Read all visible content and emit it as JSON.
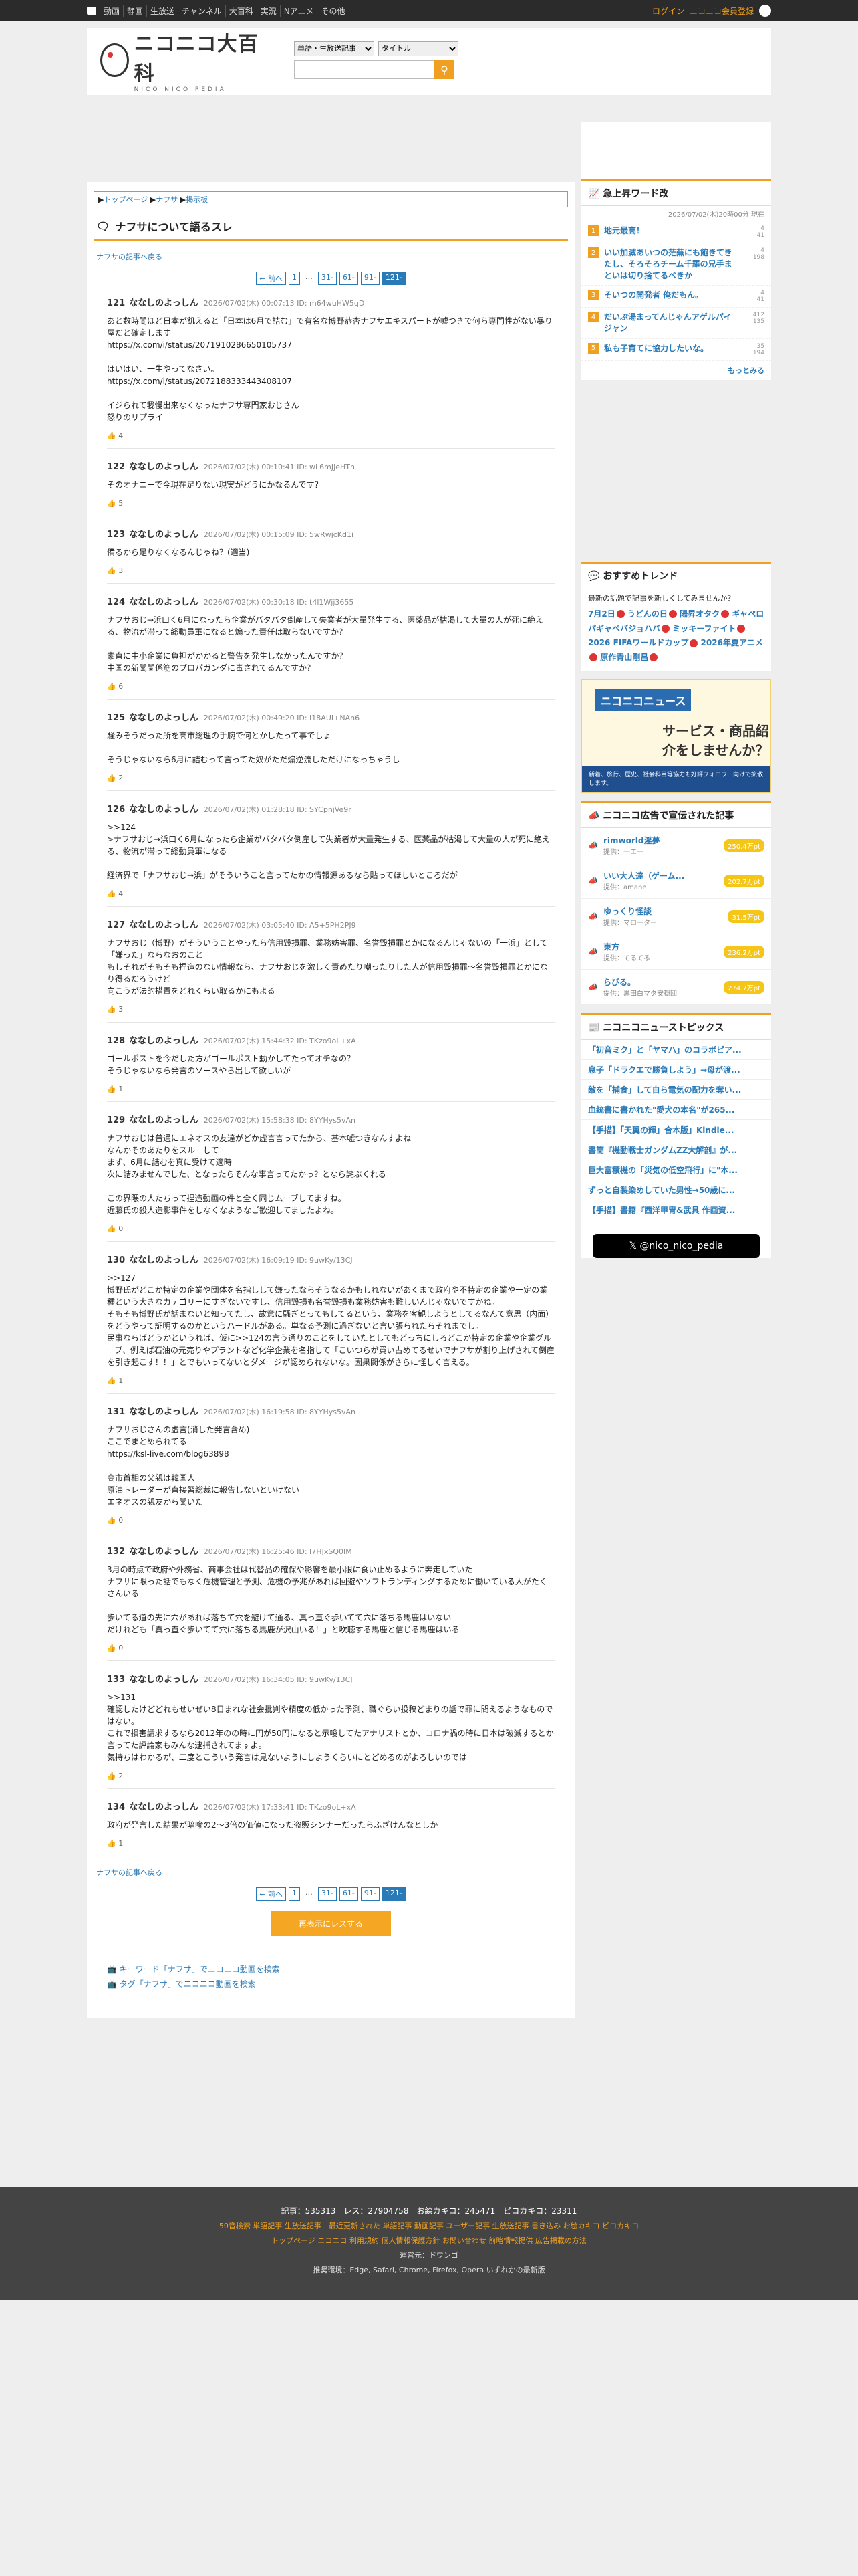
{
  "topbar": {
    "nav": [
      "動画",
      "静画",
      "生放送",
      "チャンネル",
      "大百科",
      "実況",
      "Nアニメ",
      "その他"
    ],
    "login": "ログイン",
    "register": "ニコニコ会員登録"
  },
  "header": {
    "logo_text": "ニコニコ大百科",
    "logo_sub": "NICO NICO PEDIA",
    "select1": "単語・生放送記事",
    "select2": "タイトル"
  },
  "breadcrumb": [
    "トップページ",
    "ナフサ",
    "掲示板"
  ],
  "page_title": "ナフサについて語るスレ",
  "back_label": "ナフサの記事へ戻る",
  "pager": {
    "prev": "← 前へ",
    "first": "1",
    "dots": "…",
    "p31": "31-",
    "p61": "61-",
    "p91": "91-",
    "cur": "121-"
  },
  "posts": [
    {
      "no": "121",
      "name": "ななしのよっしん",
      "meta": "2026/07/02(木) 00:07:13 ID: m64wuHW5qD",
      "body": "あと数時間ほど日本が飢えると「日本は6月で詰む」で有名な博野恭杏ナフサエキスパートが嘘つきで何ら専門性がない暴り屋だと確定します\nhttps://x.com/i/status/2071910286650105737\n\nはいはい、一生やってなさい。\nhttps://x.com/i/status/2072188333443408107\n\nイジられて我慢出来なくなったナフサ専門家おじさん\n怒りのリプライ",
      "like": "4"
    },
    {
      "no": "122",
      "name": "ななしのよっしん",
      "meta": "2026/07/02(木) 00:10:41 ID: wL6mJjeHTh",
      "body": "そのオナニーで今現在足りない現実がどうにかなるんです？",
      "like": "5"
    },
    {
      "no": "123",
      "name": "ななしのよっしん",
      "meta": "2026/07/02(木) 00:15:09 ID: 5wRwjcKd1i",
      "body": "備るから足りなくなるんじゃね？(適当)",
      "like": "3"
    },
    {
      "no": "124",
      "name": "ななしのよっしん",
      "meta": "2026/07/02(木) 00:30:18 ID: t4l1Wjj3655",
      "body": "ナフサおじ→浜口く6月になったら企業がバタバタ倒産して失業者が大量発生する、医薬品が枯渇して大量の人が死に絶える、物流が滞って総動員軍になると煽った責任は取らないですか？\n\n素直に中小企業に負担がかかると警告を発生しなかったんですか？\n中国の新聞関係筋のプロパガンダに毒されてるんですか？",
      "like": "6"
    },
    {
      "no": "125",
      "name": "ななしのよっしん",
      "meta": "2026/07/02(木) 00:49:20 ID: I18AUI+NAn6",
      "body": "騒みそうだった所を高市総理の手腕で何とかしたって事でしょ\n\nそうじゃないなら6月に詰むって言ってた奴がただ煽逆流しただけになっちゃうし",
      "like": "2"
    },
    {
      "no": "126",
      "name": "ななしのよっしん",
      "meta": "2026/07/02(木) 01:28:18 ID: SYCpnjVe9r",
      "body": ">>124\n>ナフサおじ→浜口く6月になったら企業がバタバタ倒産して失業者が大量発生する、医薬品が枯渇して大量の人が死に絶える、物流が滞って総動員軍になる\n\n経済界で「ナフサおじ→浜」がそういうこと言ってたかの情報源あるなら貼ってほしいところだが",
      "like": "4"
    },
    {
      "no": "127",
      "name": "ななしのよっしん",
      "meta": "2026/07/02(木) 03:05:40 ID: A5+5PH2PJ9",
      "body": "ナフサおじ（博野）がそういうことやったら信用毀損罪、業務妨害罪、名誉毀損罪とかになるんじゃないの「一浜」として「嫌った」ならなおのこと\nもしそれがそもそも捏造のない情報なら、ナフサおじを激しく責めたり嘲ったりした人が信用毀損罪～名誉毀損罪とかになり得るだろうけど\n向こうが法的措置をどれくらい取るかにもよる",
      "like": "3"
    },
    {
      "no": "128",
      "name": "ななしのよっしん",
      "meta": "2026/07/02(木) 15:44:32 ID: TKzo9oL+xA",
      "body": "ゴールポストを今だした方がゴールポスト動かしてたってオチなの？\nそうじゃないなら発言のソースやら出して欲しいが",
      "like": "1"
    },
    {
      "no": "129",
      "name": "ななしのよっしん",
      "meta": "2026/07/02(木) 15:58:38 ID: 8YYHys5vAn",
      "body": "ナフサおじは普通にエネオスの友達がどか虚言言ってたから、基本嘘つきなんすよね\nなんかそのあたりをスルーして\nまず、6月に詰むを真に受けて適時\n次に詰みませんでした、となったらそんな事言ってたかっ？となら詫ぶくれる\n\nこの界隈の人たちって捏造動画の件と全く同じムーブしてますね。\n近藤氏の殺人造影事件をしなくなようなご歓迎してましたよね。",
      "like": "0"
    },
    {
      "no": "130",
      "name": "ななしのよっしん",
      "meta": "2026/07/02(木) 16:09:19 ID: 9uwKy/13CJ",
      "body": ">>127\n博野氏がどこか特定の企業や団体を名指しして嫌ったならそうなるかもしれないがあくまで政府や不特定の企業や一定の業種という大きなカテゴリーにすぎないですし、信用毀損も名誉毀損も業務妨害も難しいんじゃないですかね。\nそもそも博野氏が話まないと知ってたし、故意に騒ぎとってもしてるという、業務を客観しようとしてるなんて意思（内面）をどうやって証明するのかというハードルがある。単なる予測に過ぎないと言い張られたらそれまでし。\n民事ならばどうかというれば、仮に>>124の言う通りのことをしていたとしてもどっちにしろどこか特定の企業や企業グループ、例えば石油の元売りやプラントなど化学企業を名指して「こいつらが買い占めてるせいでナフサが割り上げされて倒産を引き起こす！！」とでもいってないとダメージが認められないな。因果関係がさらに怪しく言える。",
      "like": "1"
    },
    {
      "no": "131",
      "name": "ななしのよっしん",
      "meta": "2026/07/02(木) 16:19:58 ID: 8YYHys5vAn",
      "body": "ナフサおじさんの虚言(消した発言含め)\nここでまとめられてる\nhttps://ksl-live.com/blog63898\n\n高市首相の父親は韓国人\n原油トレーダーが直接習総裁に報告しないといけない\nエネオスの親友から聞いた",
      "like": "0"
    },
    {
      "no": "132",
      "name": "ななしのよっしん",
      "meta": "2026/07/02(木) 16:25:46 ID: I7HJxSQ0IM",
      "body": "3月の時点で政府や外務省、商事会社は代替品の確保や影響を最小限に食い止めるように奔走していた\nナフサに限った話でもなく危機管理と予測、危機の予兆があれば回避やソフトランディングするために働いている人がたくさんいる\n\n歩いてる道の先に穴があれば落ちて穴を避けて通る、真っ直ぐ歩いてて穴に落ちる馬鹿はいない\nだけれども「真っ直ぐ歩いてて穴に落ちる馬鹿が沢山いる！」と吹聴する馬鹿と信じる馬鹿はいる",
      "like": "0"
    },
    {
      "no": "133",
      "name": "ななしのよっしん",
      "meta": "2026/07/02(木) 16:34:05 ID: 9uwKy/13CJ",
      "body": ">>131\n確認したけどどれもせいぜい8日まれな社会批判や精度の低かった予測、職ぐらい投稿どまりの話で罪に問えるようなものではない。\nこれで損害請求するなら2012年のの時に円が50円になると示唆してたアナリストとか、コロナ禍の時に日本は破滅するとか言ってた評論家もみんな逮捕されてますよ。\n気持ちはわかるが、二度とこういう発言は見ないようにしようくらいにとどめるのがよろしいのでは",
      "like": "2"
    },
    {
      "no": "134",
      "name": "ななしのよっしん",
      "meta": "2026/07/02(木) 17:33:41 ID: TKzo9oL+xA",
      "body": "政府が発言した結果が暗喩の2〜3倍の価値になった盗販シンナーだったらふざけんなとしか",
      "like": "1"
    }
  ],
  "show_all": "再表示にレスする",
  "footer_links": {
    "kw": "キーワード「ナフサ」でニコニコ動画を検索",
    "tag": "タグ「ナフサ」でニコニコ動画を検索"
  },
  "ranking": {
    "title": "急上昇ワード改",
    "date": "2026/07/02(木)20時00分 現在",
    "items": [
      {
        "n": "1",
        "t": "地元最高！",
        "s1": "4",
        "s2": "41"
      },
      {
        "n": "2",
        "t": "いい加減あいつの茫蕪にも飽きてきたし、そろそろチーム千羅の兄手まといは切り捨てるべきか",
        "s1": "4",
        "s2": "198"
      },
      {
        "n": "3",
        "t": "そいつの開発者 俺だもん。",
        "s1": "4",
        "s2": "41"
      },
      {
        "n": "4",
        "t": "だいぶ湯まってんじゃんアゲルパイジャン",
        "s1": "412",
        "s2": "135"
      },
      {
        "n": "5",
        "t": "私も子育てに協力したいな。",
        "s1": "35",
        "s2": "194"
      }
    ],
    "more": "もっとみる"
  },
  "trend": {
    "title": "おすすめトレンド",
    "q": "最新の話題で記事を新しくしてみませんか？",
    "tags": [
      "7月2日",
      "うどんの日",
      "陽昇オタク",
      "ギャペロパギャペバジョハバ",
      "ミッキーファイト",
      "2026 FIFAワールドカップ",
      "2026年夏アニメ",
      "原作青山剛昌"
    ]
  },
  "banner": {
    "t1": "ニコニコニュース",
    "t2": "サービス・商品紹介をしませんか？",
    "t3": "新着、旅行、歴史、社会科目等協力も好評フォロワー向けで拡散します。"
  },
  "ads": {
    "title": "ニコニコ広告で宣伝された記事",
    "items": [
      {
        "name": "rimworld淫夢",
        "by": "提供：一エー",
        "pt": "250.4万pt"
      },
      {
        "name": "いい大人達（ゲーム...",
        "by": "提供：amane",
        "pt": "202.7万pt"
      },
      {
        "name": "ゆっくり怪談",
        "by": "提供：マローター",
        "pt": "31.5万pt"
      },
      {
        "name": "東方",
        "by": "提供：てるてる",
        "pt": "236.2万pt"
      },
      {
        "name": "らびる。",
        "by": "提供：黒田白マタ安穏団",
        "pt": "274.7万pt"
      }
    ]
  },
  "news": {
    "title": "ニコニコニューストピックス",
    "items": [
      "「初音ミク」と「ヤマハ」のコラボピア...",
      "息子「ドラクエで勝負しよう」→母が渡...",
      "敵を「捕食」して自ら電気の配力を奪い...",
      "血統書に書かれた\"愛犬の本名\"が265...",
      "【手描】「天翼の輝」合本版」Kindle...",
      "書簡『機動戦士ガンダムZZ大解剖』が...",
      "巨大富積機の「災気の低空飛行」に\"本...",
      "ずっと自製染めしていた男性→50歳に...",
      "【手描】書籍『西洋甲冑&武具 作画資..."
    ],
    "x": "@nico_nico_pedia"
  },
  "footer": {
    "stats": "記事：535313　レス：27904758　お絵カキコ：245471　ピコカキコ：23311",
    "line1": "50音検索 単語記事 生放送記事　最近更新された 単語記事 動画記事 ユーザー記事 生放送記事 書き込み お絵カキコ ピコカキコ",
    "line2": "トップページ ニコニコ 利用規約 個人情報保護方針 お問い合わせ 前略情報提供 広告掲載の方法",
    "line3": "運営元：ドワンゴ",
    "line4": "推奨環境：Edge, Safari, Chrome, Firefox, Opera いずれかの最新版"
  },
  "colors": {
    "accent": "#f0a020",
    "link": "#2a7ab8",
    "dark": "#2b2b2b"
  }
}
